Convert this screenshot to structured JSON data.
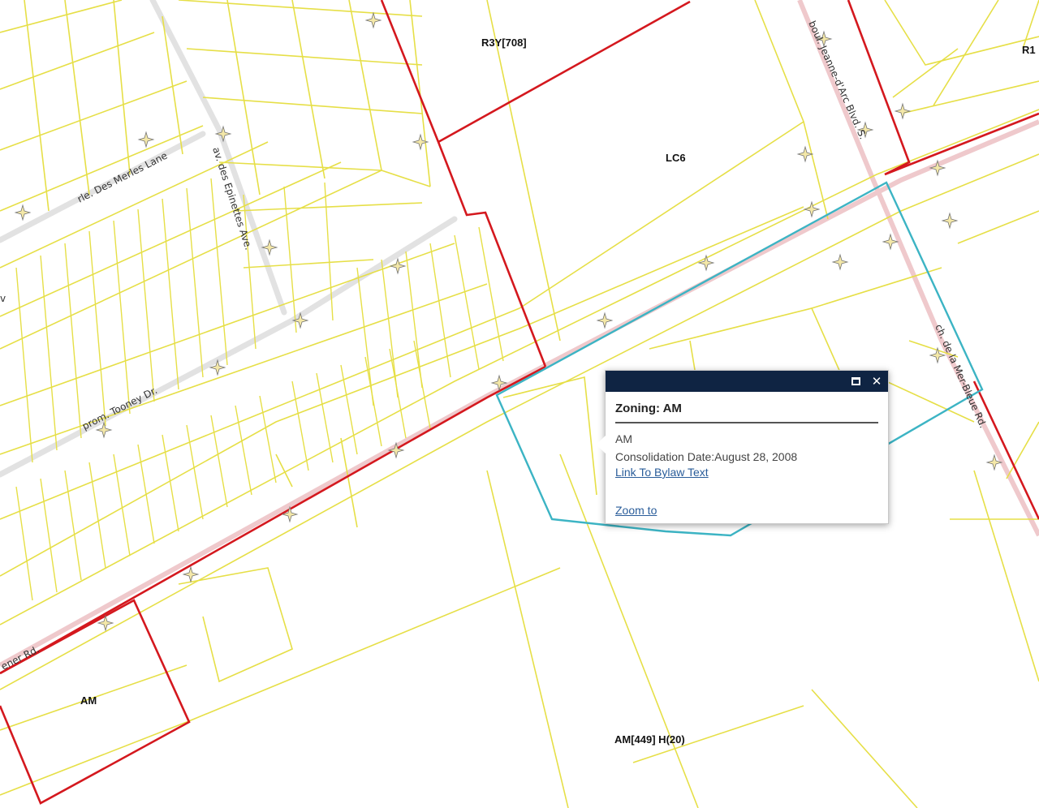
{
  "map": {
    "zone_labels": {
      "r3y": "R3Y[708]",
      "lc6": "LC6",
      "r1": "R1",
      "am_west": "AM",
      "am_south": "AM[449] H(20)"
    },
    "street_labels": {
      "merles": "rle. Des Merles Lane",
      "epinettes": "av. des Epinettes Ave.",
      "tooney": "prom. Tooney Dr.",
      "jeanne": "boul. Jeanne-d'Arc Blvd. S.",
      "merbleue": "ch. de la Mer-Bleue Rd.",
      "partial_rd": "ener Rd.",
      "partial_w": "v"
    },
    "colors": {
      "parcel": "#e8e24a",
      "zone_boundary": "#d4181e",
      "selected_zone": "#3cb4c4",
      "road": "#e0e0e0",
      "arterial": "#efc9cc"
    }
  },
  "popup": {
    "title": "Zoning: AM",
    "zone_code": "AM",
    "consolidation": "Consolidation Date:August 28, 2008",
    "bylaw_link": "Link To Bylaw Text",
    "zoom_link": "Zoom to",
    "header_color": "#0f2443"
  }
}
